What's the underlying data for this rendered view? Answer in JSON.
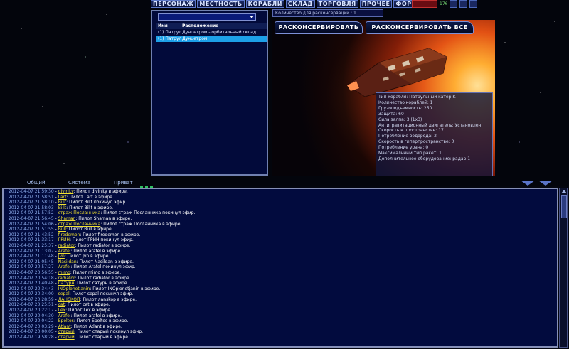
{
  "nav": {
    "items": [
      "ПЕРСОНАЖ",
      "МЕСТНОСТЬ",
      "КОРАБЛИ",
      "СКЛАД",
      "ТОРГОВЛЯ",
      "ПРОЧЕЕ",
      "ФОРУМ"
    ],
    "credits": "176"
  },
  "ship_list": {
    "dropdown_value": "",
    "headers": {
      "name": "Имя",
      "location": "Расположение"
    },
    "rows": [
      {
        "name": "(1) Патрульн",
        "location": "Дунцетром - орбитальный склад"
      },
      {
        "name": "(1) Патрульн",
        "location": "Дунцетром"
      }
    ]
  },
  "quantity_label": "Количество для расконсервации : 1",
  "buttons": {
    "decommission": "РАСКОНСЕРВИРОВАТЬ",
    "decommission_all": "РАСКОНСЕРВИРОВАТЬ ВСЕ"
  },
  "ship_info": [
    "Тип корабля: Патрульный катер К",
    "Количество кораблей: 1",
    "Грузоподъемность: 250",
    "Защита: 60",
    "Сила залпа: 3 (1x3)",
    "Антигравитационный двигатель: Установлен",
    "Скорость в пространстве: 17",
    "Потребление водорода: 2",
    "Скорость в гиперпространстве: 0",
    "Потребление урана: 0",
    "Максимальный тип ракет: 1",
    "Дополнительное оборудование: радар 1"
  ],
  "chat_tabs": [
    "Общий",
    "Система",
    "Приват"
  ],
  "chat_log": [
    {
      "time": "2012-04-07 21:59:30",
      "user": "divinity",
      "text": ": Пилот divinity в эфире."
    },
    {
      "time": "2012-04-07 21:58:51",
      "user": "Lart",
      "text": ": Пилот Lart в эфире."
    },
    {
      "time": "2012-04-07 21:58:10",
      "user": "Billt",
      "text": ": Пилот Billt покинул эфир."
    },
    {
      "time": "2012-04-07 21:58:03",
      "user": "Billt",
      "text": ": Пилот Billt в эфире."
    },
    {
      "time": "2012-04-07 21:57:52",
      "user": "страж Посланника",
      "text": ": Пилот страж Посланника покинул эфир."
    },
    {
      "time": "2012-04-07 21:56:45",
      "user": "Shaman",
      "text": ": Пилот Shaman в эфире."
    },
    {
      "time": "2012-04-07 21:54:06",
      "user": "страж Посланника",
      "text": ": Пилот страж Посланника в эфире."
    },
    {
      "time": "2012-04-07 21:51:55",
      "user": "Bull",
      "text": ": Пилот Bull в эфире."
    },
    {
      "time": "2012-04-07 21:43:52",
      "user": "firedemon",
      "text": ": Пилот firedemon в эфире."
    },
    {
      "time": "2012-04-07 21:33:17",
      "user": "ГРИН",
      "text": ": Пилот ГРИН покинул эфир."
    },
    {
      "time": "2012-04-07 21:25:37",
      "user": "radiator",
      "text": ": Пилот radiator в эфире."
    },
    {
      "time": "2012-04-07 21:13:07",
      "user": "Arafel",
      "text": ": Пилот arafel в эфире."
    },
    {
      "time": "2012-04-07 21:11:48",
      "user": "Jvn",
      "text": ": Пилот Jvn в эфире."
    },
    {
      "time": "2012-04-07 21:05:45",
      "user": "Nasildan",
      "text": ": Пилот Nasildan в эфире."
    },
    {
      "time": "2012-04-07 20:57:27",
      "user": "Arafel",
      "text": ": Пилот Arafel покинул эфир."
    },
    {
      "time": "2012-04-07 20:56:55",
      "user": "mimo",
      "text": ": Пилот mimo в эфире."
    },
    {
      "time": "2012-04-07 20:54:18",
      "user": "radiator",
      "text": ": Пилот radiator в эфире."
    },
    {
      "time": "2012-04-07 20:40:48",
      "user": "Сатурн",
      "text": ": Пилот сатурн в эфире."
    },
    {
      "time": "2012-04-07 20:34:43",
      "user": "INOplonetjanin",
      "text": ": Пилот INOplonetjanin в эфире."
    },
    {
      "time": "2012-04-07 20:34:00",
      "user": "sepal",
      "text": ": Пилот sepal покинул эфир."
    },
    {
      "time": "2012-04-07 20:28:59",
      "user": "ЛАНСКОП",
      "text": ": Пилот лanskop в эфире."
    },
    {
      "time": "2012-04-07 20:25:51",
      "user": "cat",
      "text": ": Пилот cat в эфире."
    },
    {
      "time": "2012-04-07 20:22:17",
      "user": "Lex",
      "text": ": Пилот Lex в эфире."
    },
    {
      "time": "2012-04-07 20:04:30",
      "user": "Arafel",
      "text": ": Пилот arafel в эфире."
    },
    {
      "time": "2012-04-07 20:04:22",
      "user": "Epoltos",
      "text": ": Пилот Epoltos в эфире."
    },
    {
      "time": "2012-04-07 20:03:29",
      "user": "Atlant",
      "text": ": Пилот Atlant в эфире."
    },
    {
      "time": "2012-04-07 20:00:05",
      "user": "старый",
      "text": ": Пилот старый покинул эфир."
    },
    {
      "time": "2012-04-07 19:58:28",
      "user": "старый",
      "text": ": Пилот старый в эфире."
    }
  ],
  "colors": {
    "accent": "#1da0e8",
    "username": "#f0e030",
    "panel": "#020b3e"
  }
}
